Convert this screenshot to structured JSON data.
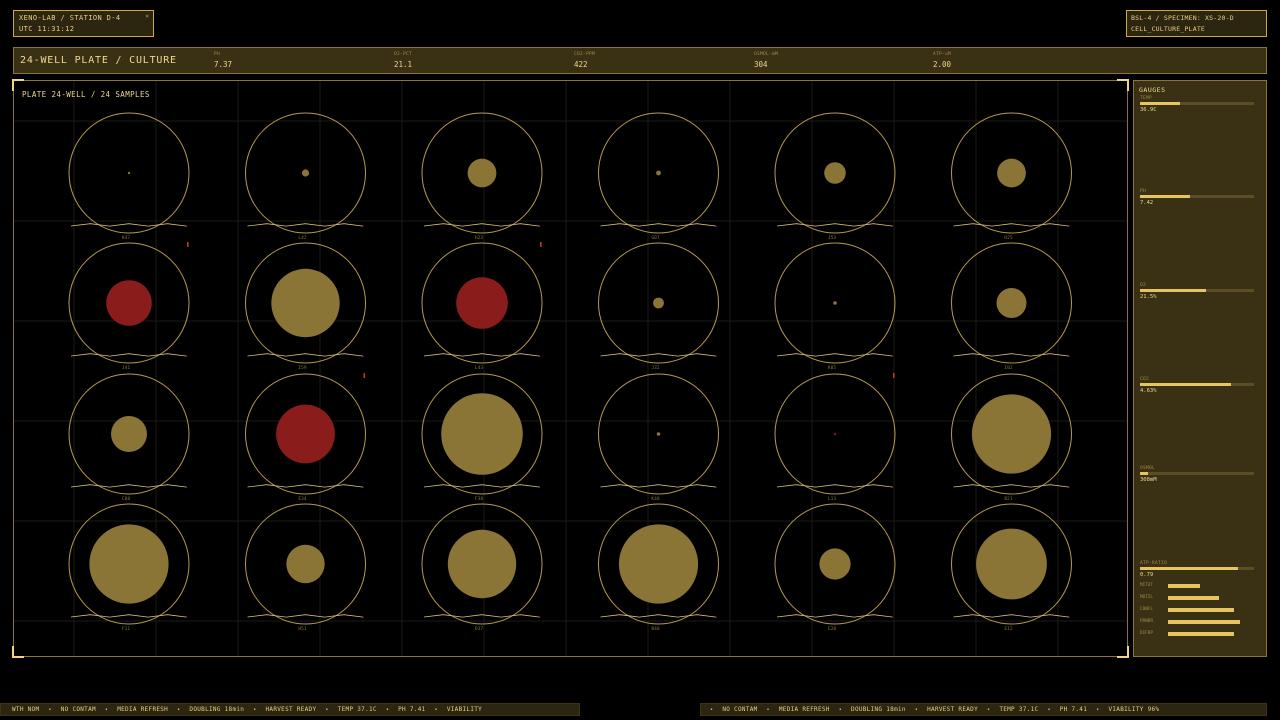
{
  "header_left": {
    "line1": "XENO-LAB / STATION D-4",
    "line2": "UTC 11:31:12",
    "close_glyph": "×"
  },
  "header_right": {
    "line1": "BSL-4 / SPECIMEN: XS-20-D",
    "line2": "CELL_CULTURE_PLATE"
  },
  "title_bar": {
    "title": "24-WELL PLATE / CULTURE",
    "metrics": [
      {
        "key": "PH",
        "value": "7.37"
      },
      {
        "key": "O2-PCT",
        "value": "21.1"
      },
      {
        "key": "CO2-PPM",
        "value": "422"
      },
      {
        "key": "OSMOL-mM",
        "value": "304"
      },
      {
        "key": "ATP-uM",
        "value": "2.00"
      }
    ]
  },
  "plate": {
    "label": "PLATE 24-WELL  /  24 SAMPLES",
    "colors": {
      "ring": "#b79a4f",
      "culture": "#8a7436",
      "contaminated": "#8a1c1c",
      "flag": "#c0362c"
    },
    "wells": [
      {
        "id": "K47",
        "level": 0.02,
        "status": "normal",
        "flag": false
      },
      {
        "id": "L42",
        "level": 0.06,
        "status": "normal",
        "flag": false
      },
      {
        "id": "H23",
        "level": 0.24,
        "status": "normal",
        "flag": false
      },
      {
        "id": "G07",
        "level": 0.04,
        "status": "normal",
        "flag": false
      },
      {
        "id": "J53",
        "level": 0.18,
        "status": "normal",
        "flag": false
      },
      {
        "id": "H25",
        "level": 0.24,
        "status": "normal",
        "flag": false
      },
      {
        "id": "J41",
        "level": 0.38,
        "status": "contaminated",
        "flag": true
      },
      {
        "id": "I59",
        "level": 0.57,
        "status": "normal",
        "flag": false
      },
      {
        "id": "L43",
        "level": 0.43,
        "status": "contaminated",
        "flag": true
      },
      {
        "id": "J32",
        "level": 0.09,
        "status": "normal",
        "flag": false
      },
      {
        "id": "K05",
        "level": 0.03,
        "status": "normal",
        "flag": false
      },
      {
        "id": "I02",
        "level": 0.25,
        "status": "normal",
        "flag": false
      },
      {
        "id": "C08",
        "level": 0.3,
        "status": "normal",
        "flag": false
      },
      {
        "id": "E34",
        "level": 0.49,
        "status": "contaminated",
        "flag": true
      },
      {
        "id": "F38",
        "level": 0.68,
        "status": "normal",
        "flag": false
      },
      {
        "id": "K40",
        "level": 0.03,
        "status": "normal",
        "flag": false
      },
      {
        "id": "L13",
        "level": 0.02,
        "status": "contaminated",
        "flag": true
      },
      {
        "id": "B21",
        "level": 0.66,
        "status": "normal",
        "flag": false
      },
      {
        "id": "F11",
        "level": 0.66,
        "status": "normal",
        "flag": false
      },
      {
        "id": "H51",
        "level": 0.32,
        "status": "normal",
        "flag": false
      },
      {
        "id": "D37",
        "level": 0.57,
        "status": "normal",
        "flag": false
      },
      {
        "id": "B40",
        "level": 0.66,
        "status": "normal",
        "flag": false
      },
      {
        "id": "E20",
        "level": 0.26,
        "status": "normal",
        "flag": false
      },
      {
        "id": "E12",
        "level": 0.59,
        "status": "normal",
        "flag": false
      }
    ]
  },
  "gauges": {
    "title": "GAUGES",
    "items": [
      {
        "label": "TEMP",
        "value": "36.9C",
        "fraction": 0.35
      },
      {
        "label": "PH",
        "value": "7.42",
        "fraction": 0.44
      },
      {
        "label": "O2",
        "value": "21.5%",
        "fraction": 0.58
      },
      {
        "label": "CO2",
        "value": "4.63%",
        "fraction": 0.8
      },
      {
        "label": "OSMOL",
        "value": "308mM",
        "fraction": 0.07
      },
      {
        "label": "ATP-RATIO",
        "value": "0.79",
        "fraction": 0.86
      }
    ],
    "subbars": [
      {
        "label": "MITOT",
        "fraction": 0.4
      },
      {
        "label": "MOTIL",
        "fraction": 0.64
      },
      {
        "label": "CONFL",
        "fraction": 0.82
      },
      {
        "label": "PRNDR",
        "fraction": 0.9
      },
      {
        "label": "DIFRP",
        "fraction": 0.83
      }
    ]
  },
  "ticker_left": [
    "WTH NOM",
    "NO CONTAM",
    "MEDIA REFRESH",
    "DOUBLING 18min",
    "HARVEST READY",
    "TEMP 37.1C",
    "PH 7.41",
    "VIABILITY"
  ],
  "ticker_right": [
    "NO CONTAM",
    "MEDIA REFRESH",
    "DOUBLING 18min",
    "HARVEST READY",
    "TEMP 37.1C",
    "PH 7.41",
    "VIABILITY 96%"
  ],
  "ticker_sep": "•"
}
